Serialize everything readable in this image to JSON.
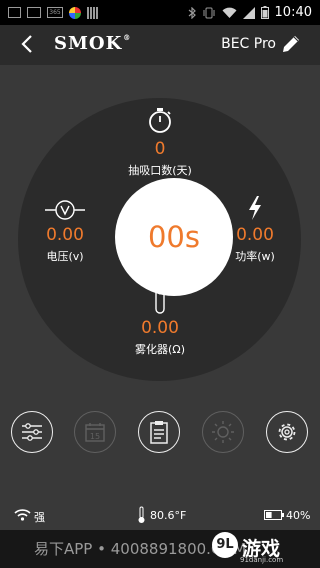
{
  "status_bar": {
    "time": "10:40",
    "left_icons": [
      "photo-icon",
      "mail-icon",
      "app-365-icon",
      "flower-app-icon",
      "barcode-icon"
    ],
    "right_icons": [
      "bluetooth-icon",
      "vibrate-icon",
      "wifi-icon",
      "signal-icon",
      "battery-icon"
    ],
    "app_365_label": "365"
  },
  "app_bar": {
    "brand": "SMOK",
    "brand_mark": "®",
    "device_name": "BEC Pro"
  },
  "dashboard": {
    "timer": "00s",
    "puffs": {
      "value": "0",
      "label": "抽吸口数(天)",
      "icon": "stopwatch-icon"
    },
    "voltage": {
      "value": "0.00",
      "label": "电压(v)",
      "icon": "voltmeter-icon"
    },
    "power": {
      "value": "0.00",
      "label": "功率(w)",
      "icon": "lightning-icon"
    },
    "atomizer": {
      "value": "0.00",
      "label": "雾化器(Ω)",
      "icon": "atomizer-icon"
    }
  },
  "bottom_buttons": [
    {
      "name": "sliders-icon",
      "enabled": true
    },
    {
      "name": "calendar-icon",
      "enabled": false,
      "text": "15"
    },
    {
      "name": "clipboard-icon",
      "enabled": true
    },
    {
      "name": "brightness-icon",
      "enabled": false
    },
    {
      "name": "gear-icon",
      "enabled": true
    }
  ],
  "device_status": {
    "signal_label": "强",
    "temperature": "80.6°F",
    "battery": "40%"
  },
  "footer": {
    "text": "易下APP • 4008891800.COM",
    "watermark_mark": "9L",
    "watermark_text": "游戏",
    "watermark_sub": "91danji.com"
  },
  "colors": {
    "accent": "#ef7a2d",
    "background": "#393939",
    "panel": "#2b2b2b"
  }
}
